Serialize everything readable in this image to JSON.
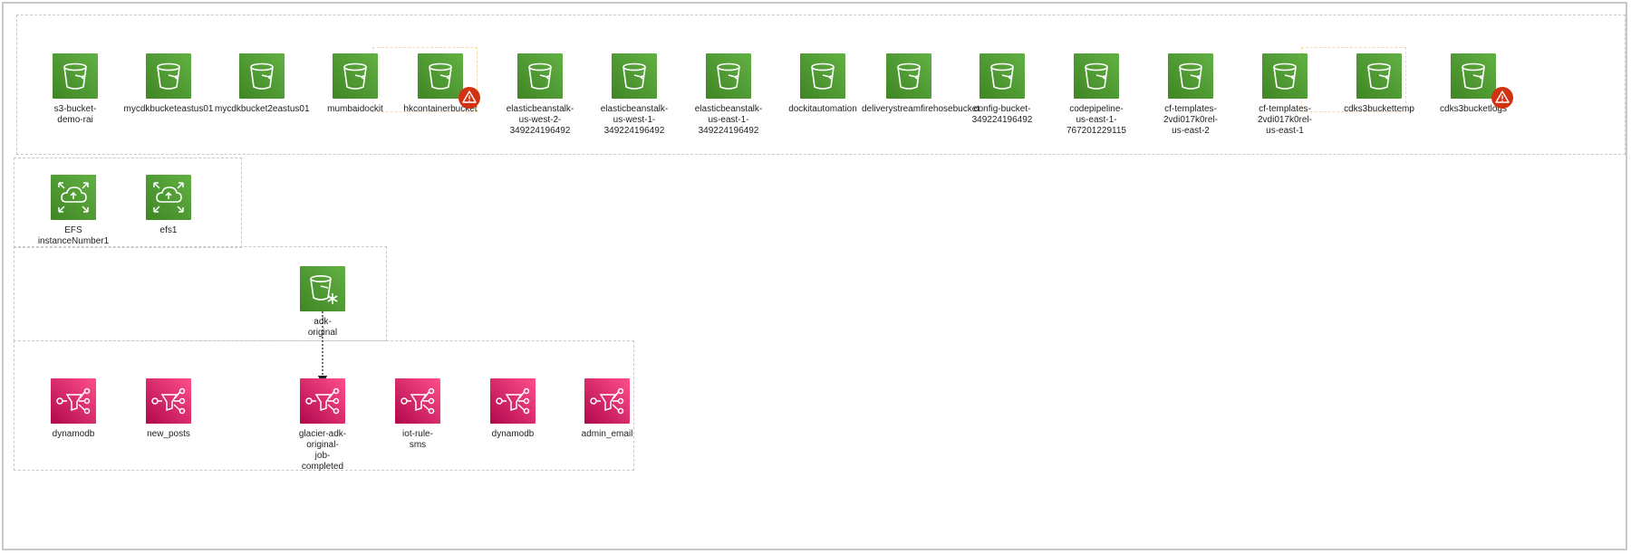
{
  "groups": {
    "s3_buckets": [
      {
        "label": "s3-bucket-\ndemo-rai",
        "icon": "s3-bucket-icon"
      },
      {
        "label": "mycdkbucketeastus01",
        "icon": "s3-bucket-icon"
      },
      {
        "label": "mycdkbucket2eastus01",
        "icon": "s3-bucket-icon"
      },
      {
        "label": "mumbaidockit",
        "icon": "s3-bucket-icon"
      },
      {
        "label": "hkcontainerbucket",
        "icon": "s3-bucket-icon",
        "alert": true
      },
      {
        "label": "elasticbeanstalk-\nus-west-2-\n349224196492",
        "icon": "s3-bucket-icon"
      },
      {
        "label": "elasticbeanstalk-\nus-west-1-\n349224196492",
        "icon": "s3-bucket-icon"
      },
      {
        "label": "elasticbeanstalk-\nus-east-1-\n349224196492",
        "icon": "s3-bucket-icon"
      },
      {
        "label": "dockitautomation",
        "icon": "s3-bucket-icon"
      },
      {
        "label": "deliverystreamfirehosebucket",
        "icon": "s3-bucket-icon"
      },
      {
        "label": "config-bucket-\n349224196492",
        "icon": "s3-bucket-icon"
      },
      {
        "label": "codepipeline-\nus-east-1-\n767201229115",
        "icon": "s3-bucket-icon"
      },
      {
        "label": "cf-templates-\n2vdi017k0rel-\nus-east-2",
        "icon": "s3-bucket-icon"
      },
      {
        "label": "cf-templates-\n2vdi017k0rel-\nus-east-1",
        "icon": "s3-bucket-icon"
      },
      {
        "label": "cdks3buckettemp",
        "icon": "s3-bucket-icon"
      },
      {
        "label": "cdks3bucketlogs",
        "icon": "s3-bucket-icon",
        "alert": true
      }
    ],
    "efs": [
      {
        "label": "EFS\ninstanceNumber1",
        "icon": "efs-icon"
      },
      {
        "label": "efs1",
        "icon": "efs-icon"
      }
    ],
    "glacier": [
      {
        "label": "adk-\noriginal",
        "icon": "glacier-bucket-icon"
      }
    ],
    "sns_topics": [
      {
        "label": "dynamodb",
        "icon": "sns-topic-icon"
      },
      {
        "label": "new_posts",
        "icon": "sns-topic-icon"
      },
      {
        "label": "glacier-adk-\noriginal-\njob-\ncompleted",
        "icon": "sns-topic-icon"
      },
      {
        "label": "iot-rule-\nsms",
        "icon": "sns-topic-icon"
      },
      {
        "label": "dynamodb",
        "icon": "sns-topic-icon"
      },
      {
        "label": "admin_email",
        "icon": "sns-topic-icon"
      }
    ]
  },
  "connections": [
    {
      "from": "adk-original",
      "to": "glacier-adk-original-job-completed",
      "style": "dotted-arrow"
    }
  ],
  "colors": {
    "storage_green": "#3f8624",
    "messaging_pink": "#e7157b",
    "alert_red": "#d13212",
    "group_border": "#c9c9c9"
  }
}
